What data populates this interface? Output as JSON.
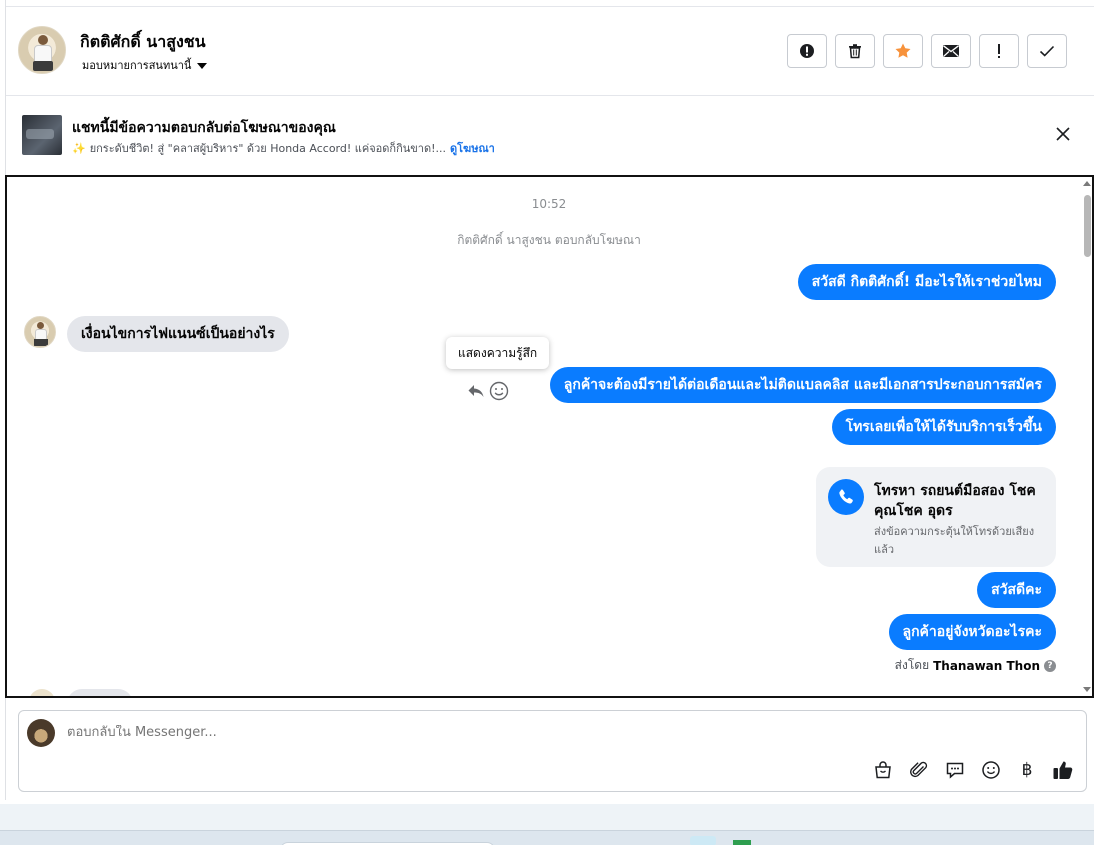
{
  "header": {
    "contact_name": "กิตติศักดิ์ นาสูงชน",
    "assign_label": "มอบหมายการสนทนานี้",
    "actions": [
      "report-icon",
      "trash-icon",
      "star-icon",
      "mail-icon",
      "exclaim-icon",
      "check-icon"
    ]
  },
  "ad": {
    "title": "แชทนี้มีข้อความตอบกลับต่อโฆษณาของคุณ",
    "subtitle": "ยกระดับชีวิต! สู่ \"คลาสผู้บริหาร\" ด้วย Honda Accord! แค่จอดก็กินขาด!...",
    "link": "ดูโฆษณา",
    "spark": "✨"
  },
  "chat": {
    "timestamp": "10:52",
    "system_note": "กิตติศักดิ์ นาสูงชน ตอบกลับโฆษณา",
    "messages": [
      {
        "dir": "out",
        "text": "สวัสดี กิตติศักดิ์! มีอะไรให้เราช่วยไหม"
      },
      {
        "dir": "in",
        "text": "เงื่อนไขการไฟแนนซ์เป็นอย่างไร"
      },
      {
        "dir": "out",
        "text": "ลูกค้าจะต้องมีรายได้ต่อเดือนและไม่ติดแบลคลิส และมีเอกสารประกอบการสมัคร"
      },
      {
        "dir": "out",
        "text": "โทรเลยเพื่อให้ได้รับบริการเร็วขึ้น"
      },
      {
        "dir": "out",
        "text": "สวัสดีคะ"
      },
      {
        "dir": "out",
        "text": "ลูกค้าอยู่จังหวัดอะไรคะ"
      }
    ],
    "tooltip": "แสดงความรู้สึก",
    "call_card": {
      "title": "โทรหา รถยนต์มือสอง โชคคุณโชค อุดร",
      "subtitle": "ส่งข้อความกระตุ้นให้โทรด้วยเสียงแล้ว"
    },
    "sent_by_label": "ส่งโดย",
    "sent_by_name": "Thanawan Thon",
    "help": "?"
  },
  "composer": {
    "placeholder": "ตอบกลับใน Messenger...",
    "tools": [
      "shopping-bag-icon",
      "paperclip-icon",
      "saved-reply-icon",
      "emoji-icon",
      "baht-icon",
      "like-icon"
    ],
    "baht_symbol": "฿"
  },
  "colors": {
    "accent": "#0a7cff",
    "incoming_bubble": "#e4e6eb",
    "star": "#f7923b"
  }
}
